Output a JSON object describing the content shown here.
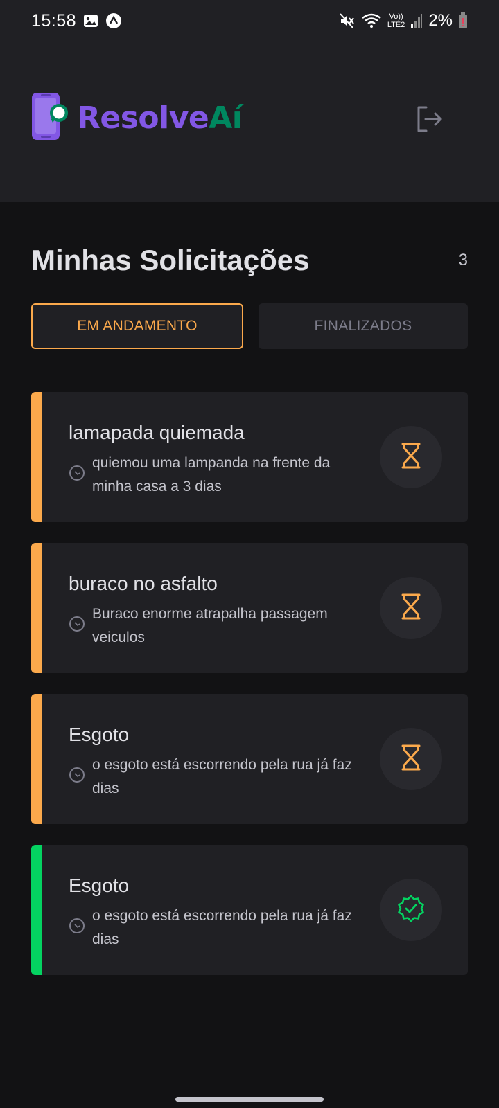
{
  "status_bar": {
    "time": "15:58",
    "network": "LTE2",
    "volte": "Vo))",
    "battery": "2%",
    "icons": [
      "image-icon",
      "app-notification-icon",
      "mute-icon",
      "wifi-icon",
      "signal-icon",
      "battery-icon"
    ]
  },
  "header": {
    "logo_part1": "Resolve",
    "logo_part2": "Aí",
    "logo_icon": "phone-chat-icon",
    "logout_icon": "logout-icon"
  },
  "main": {
    "title": "Minhas Solicitações",
    "count": "3",
    "tabs": [
      {
        "label": "EM ANDAMENTO",
        "active": true
      },
      {
        "label": "FINALIZADOS",
        "active": false
      }
    ]
  },
  "requests": [
    {
      "title": "lamapada quiemada",
      "description": "quiemou uma lampanda na frente da minha casa a 3 dias",
      "status": "em-andamento",
      "status_icon": "hourglass-icon",
      "accent": "#fba94c"
    },
    {
      "title": "buraco no asfalto",
      "description": "Buraco enorme atrapalha passagem veiculos",
      "status": "em-andamento",
      "status_icon": "hourglass-icon",
      "accent": "#fba94c"
    },
    {
      "title": "Esgoto",
      "description": "o esgoto está escorrendo pela rua já faz dias",
      "status": "em-andamento",
      "status_icon": "hourglass-icon",
      "accent": "#fba94c"
    },
    {
      "title": "Esgoto",
      "description": "o esgoto está escorrendo pela rua já faz dias",
      "status": "finalizado",
      "status_icon": "check-badge-icon",
      "accent": "#04d361"
    }
  ],
  "colors": {
    "background": "#121214",
    "surface": "#202024",
    "brand_purple": "#8257e5",
    "brand_green": "#00875f",
    "pending": "#fba94c",
    "done": "#04d361"
  }
}
